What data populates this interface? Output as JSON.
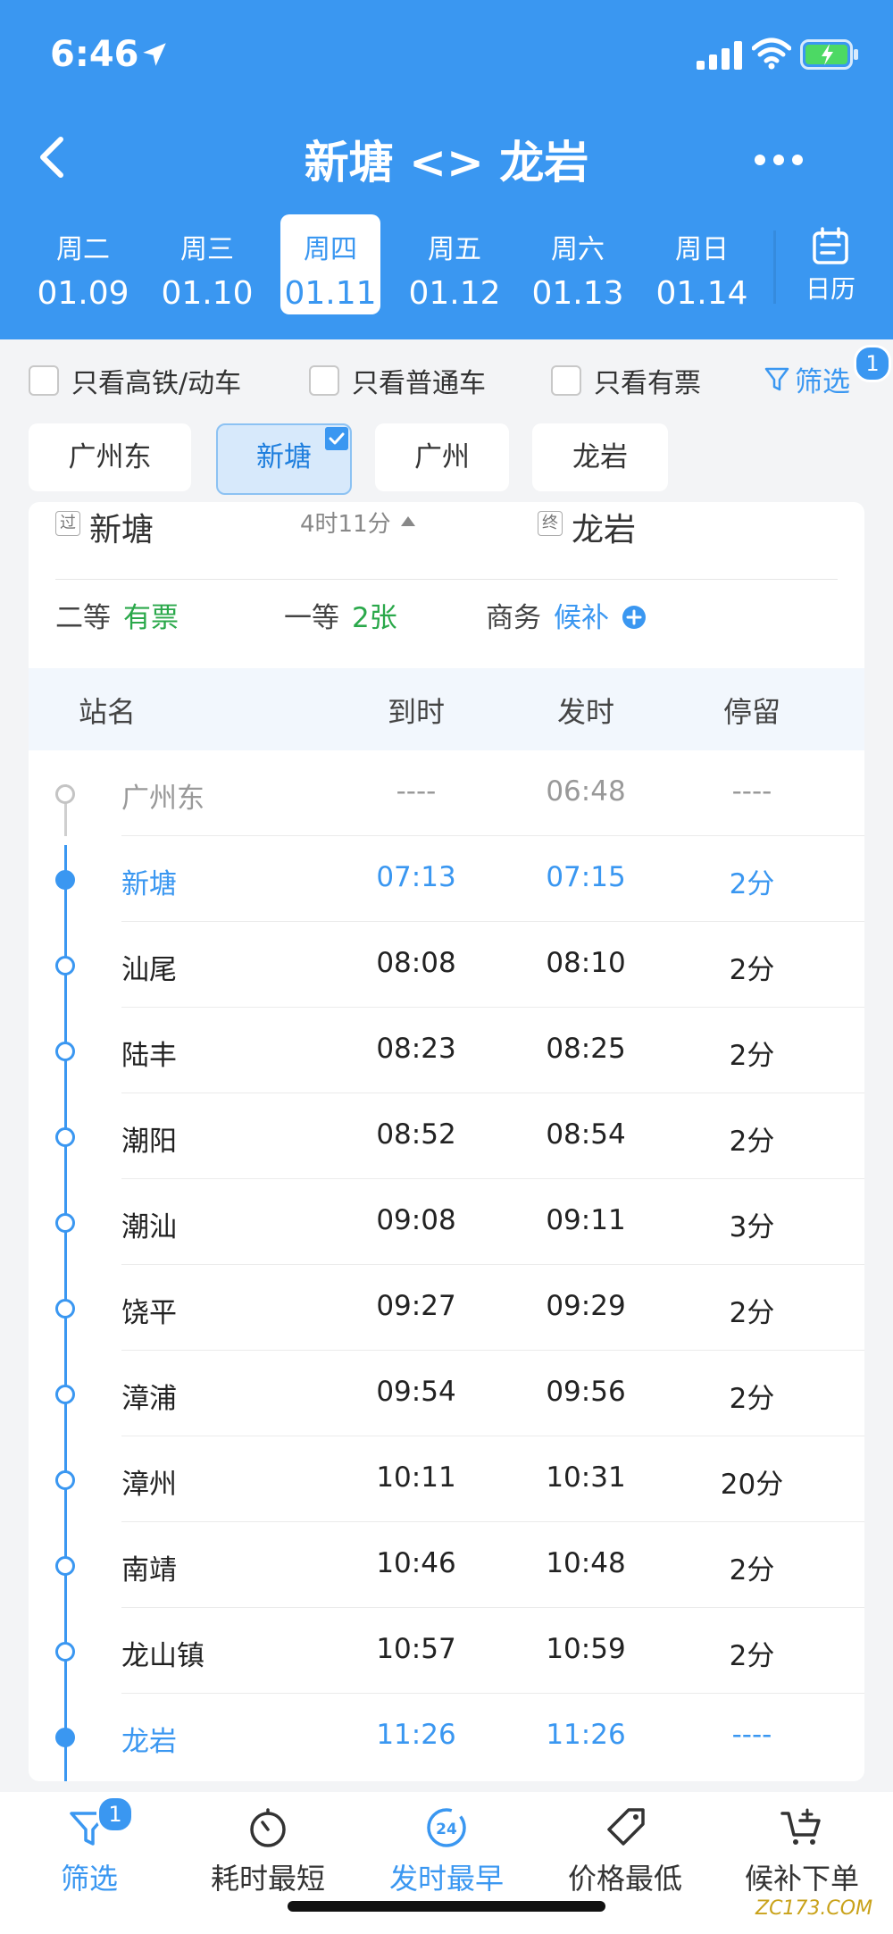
{
  "status": {
    "time": "6:46"
  },
  "nav": {
    "title": "新塘 <> 龙岩"
  },
  "dates": [
    {
      "weekday": "周二",
      "date": "01.09"
    },
    {
      "weekday": "周三",
      "date": "01.10"
    },
    {
      "weekday": "周四",
      "date": "01.11",
      "active": true
    },
    {
      "weekday": "周五",
      "date": "01.12"
    },
    {
      "weekday": "周六",
      "date": "01.13"
    },
    {
      "weekday": "周日",
      "date": "01.14"
    }
  ],
  "calendar_label": "日历",
  "filters": {
    "high_speed": "只看高铁/动车",
    "normal": "只看普通车",
    "has_ticket": "只看有票",
    "filter_label": "筛选",
    "filter_badge": "1"
  },
  "chips": [
    "广州东",
    "新塘",
    "广州",
    "龙岩"
  ],
  "route": {
    "from_tag": "过",
    "from": "新塘",
    "duration": "4时11分",
    "to_tag": "终",
    "to": "龙岩"
  },
  "seats": [
    {
      "class": "二等",
      "value": "有票"
    },
    {
      "class": "一等",
      "value": "2张"
    },
    {
      "class": "商务",
      "value": "候补"
    }
  ],
  "table": {
    "headers": [
      "站名",
      "到时",
      "发时",
      "停留"
    ],
    "rows": [
      {
        "name": "广州东",
        "arrive": "----",
        "depart": "06:48",
        "stay": "----"
      },
      {
        "name": "新塘",
        "arrive": "07:13",
        "depart": "07:15",
        "stay": "2分"
      },
      {
        "name": "汕尾",
        "arrive": "08:08",
        "depart": "08:10",
        "stay": "2分"
      },
      {
        "name": "陆丰",
        "arrive": "08:23",
        "depart": "08:25",
        "stay": "2分"
      },
      {
        "name": "潮阳",
        "arrive": "08:52",
        "depart": "08:54",
        "stay": "2分"
      },
      {
        "name": "潮汕",
        "arrive": "09:08",
        "depart": "09:11",
        "stay": "3分"
      },
      {
        "name": "饶平",
        "arrive": "09:27",
        "depart": "09:29",
        "stay": "2分"
      },
      {
        "name": "漳浦",
        "arrive": "09:54",
        "depart": "09:56",
        "stay": "2分"
      },
      {
        "name": "漳州",
        "arrive": "10:11",
        "depart": "10:31",
        "stay": "20分"
      },
      {
        "name": "南靖",
        "arrive": "10:46",
        "depart": "10:48",
        "stay": "2分"
      },
      {
        "name": "龙山镇",
        "arrive": "10:57",
        "depart": "10:59",
        "stay": "2分"
      },
      {
        "name": "龙岩",
        "arrive": "11:26",
        "depart": "11:26",
        "stay": "----"
      }
    ]
  },
  "bottom_tabs": [
    {
      "label": "筛选",
      "icon": "funnel-icon",
      "badge": "1"
    },
    {
      "label": "耗时最短",
      "icon": "stopwatch-icon"
    },
    {
      "label": "发时最早",
      "icon": "clock-24-icon",
      "icon_text": "24"
    },
    {
      "label": "价格最低",
      "icon": "price-tag-icon"
    },
    {
      "label": "候补下单",
      "icon": "cart-plus-icon"
    }
  ],
  "colors": {
    "primary": "#3a97f1",
    "green": "#2aa84a",
    "gray_text": "#999999"
  },
  "watermark": "ZC173.COM"
}
